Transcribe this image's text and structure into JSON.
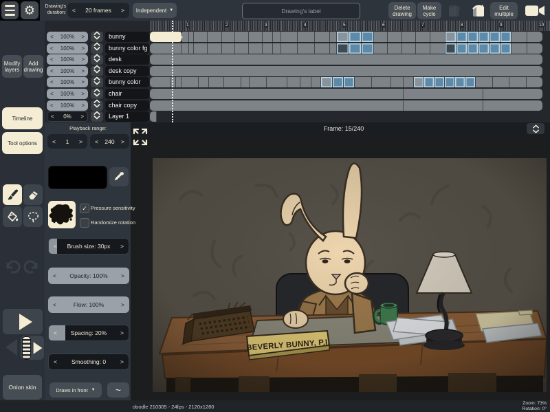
{
  "glyphs": {
    "prev": "<",
    "next": ">",
    "dropdown": "▼",
    "check": "✓",
    "squiggle": "~"
  },
  "colors": {
    "accent_cream": "#f5edd3",
    "panel_dark": "#24282d",
    "button_gray": "#464d55",
    "timeline_cell_gray": "#7e8388",
    "selected_cell_blue": "#5d8aa9",
    "blue_border": "#b9d6e6"
  },
  "topbar": {
    "drawings_duration_label": "Drawing's duration:",
    "duration_value": "20 frames",
    "independent_dropdown": "Independent",
    "drawings_label_placeholder": "Drawing's label",
    "delete_drawing": "Delete drawing",
    "make_cycle": "Make cycle",
    "edit_multiple": "Edit multiple"
  },
  "sidebar": {
    "modify_layers": "Modify layers",
    "add_drawing": "Add drawing",
    "timeline_tab": "Timeline",
    "tool_options_tab": "Tool options",
    "onion_skin": "Onion skin"
  },
  "layers": {
    "rows": [
      {
        "opacity": "100%",
        "name": "bunny"
      },
      {
        "opacity": "100%",
        "name": "bunny color fg"
      },
      {
        "opacity": "100%",
        "name": "desk"
      },
      {
        "opacity": "100%",
        "name": "desk copy"
      },
      {
        "opacity": "100%",
        "name": "bunny color"
      },
      {
        "opacity": "100%",
        "name": "chair"
      },
      {
        "opacity": "100%",
        "name": "chair copy"
      },
      {
        "opacity": "0%",
        "name": "Layer 1",
        "dim": true
      }
    ]
  },
  "timeline": {
    "ruler_numbers": [
      "1",
      "2",
      "3",
      "4",
      "5",
      "6",
      "7",
      "8",
      "9",
      "10"
    ],
    "frame_label": "Frame: 15/240",
    "playback_range_label": "Playback range:",
    "playback_start": "1",
    "playback_end": "240",
    "tracks": [
      {
        "name": "bunny",
        "segs": [
          [
            "s",
            47
          ],
          [
            "g",
            10
          ],
          [
            "g",
            7
          ],
          [
            "g",
            20
          ],
          [
            "g",
            21
          ],
          [
            "g",
            19
          ],
          [
            "g",
            20
          ],
          [
            "g",
            20
          ],
          [
            "g",
            15
          ],
          [
            "g",
            12
          ],
          [
            "g",
            24
          ],
          [
            "g",
            25
          ],
          [
            "g",
            22
          ],
          [
            "g",
            10
          ],
          [
            "bl",
            18
          ],
          [
            "b",
            18
          ],
          [
            "b",
            18
          ],
          [
            "g",
            20
          ],
          [
            "g",
            21
          ],
          [
            "g",
            20
          ],
          [
            "g",
            21
          ],
          [
            "g",
            22
          ],
          [
            "bl",
            16
          ],
          [
            "b",
            16
          ],
          [
            "b",
            16
          ],
          [
            "b",
            16
          ],
          [
            "b",
            16
          ],
          [
            "b",
            16
          ],
          [
            "g",
            23
          ],
          [
            "g",
            22
          ]
        ]
      },
      {
        "name": "bunny color fg",
        "segs": [
          [
            "g",
            47
          ],
          [
            "g",
            10
          ],
          [
            "g",
            7
          ],
          [
            "g",
            20
          ],
          [
            "g",
            21
          ],
          [
            "g",
            19
          ],
          [
            "g",
            20
          ],
          [
            "g",
            20
          ],
          [
            "g",
            15
          ],
          [
            "g",
            12
          ],
          [
            "g",
            24
          ],
          [
            "g",
            25
          ],
          [
            "g",
            22
          ],
          [
            "g",
            10
          ],
          [
            "bd",
            18
          ],
          [
            "b",
            18
          ],
          [
            "b",
            18
          ],
          [
            "g",
            20
          ],
          [
            "g",
            21
          ],
          [
            "g",
            20
          ],
          [
            "g",
            21
          ],
          [
            "g",
            22
          ],
          [
            "bd",
            16
          ],
          [
            "b",
            16
          ],
          [
            "b",
            16
          ],
          [
            "b",
            16
          ],
          [
            "b",
            16
          ],
          [
            "b",
            16
          ],
          [
            "g",
            23
          ],
          [
            "g",
            22
          ]
        ]
      },
      {
        "name": "desk",
        "segs": [
          [
            "g",
            571
          ]
        ]
      },
      {
        "name": "desk copy",
        "segs": [
          [
            "g",
            571
          ]
        ]
      },
      {
        "name": "bunny color",
        "segs": [
          [
            "g",
            30
          ],
          [
            "g",
            8
          ],
          [
            "g",
            8
          ],
          [
            "g",
            25
          ],
          [
            "g",
            15
          ],
          [
            "g",
            22
          ],
          [
            "g",
            25
          ],
          [
            "g",
            12
          ],
          [
            "g",
            25
          ],
          [
            "g",
            30
          ],
          [
            "g",
            19
          ],
          [
            "g",
            16
          ],
          [
            "g",
            14
          ],
          [
            "bl",
            17
          ],
          [
            "b",
            16
          ],
          [
            "b",
            16
          ],
          [
            "g",
            25
          ],
          [
            "g",
            28
          ],
          [
            "g",
            18
          ],
          [
            "g",
            15
          ],
          [
            "bl",
            15
          ],
          [
            "b",
            15
          ],
          [
            "b",
            15
          ],
          [
            "b",
            15
          ],
          [
            "b",
            15
          ],
          [
            "b",
            15
          ],
          [
            "g",
            25
          ],
          [
            "g",
            24
          ],
          [
            "g",
            25
          ],
          [
            "g",
            23
          ]
        ]
      },
      {
        "name": "chair",
        "segs": [
          [
            "g",
            369
          ],
          [
            "g",
            116
          ],
          [
            "g",
            86
          ]
        ]
      },
      {
        "name": "chair copy",
        "segs": [
          [
            "g",
            369
          ],
          [
            "g",
            116
          ],
          [
            "g",
            86
          ]
        ]
      },
      {
        "name": "Layer 1",
        "segs": [
          [
            "g",
            10
          ],
          [
            "x",
            561
          ]
        ]
      }
    ]
  },
  "tool_options": {
    "pressure_sensitivity": "Pressure sensitivity",
    "pressure_checked": true,
    "randomize_rotation": "Randomize rotation",
    "randomize_checked": false,
    "brush_size": "Brush size: 30px",
    "opacity": "Opacity: 100%",
    "flow": "Flow: 100%",
    "spacing": "Spacing: 20%",
    "smoothing": "Smoothing: 0",
    "draws_in_front": "Draws in front"
  },
  "statusbar": {
    "project_info": "doodle 210305 - 24fps - 2120x1280",
    "zoom": "Zoom: 73%",
    "rotation": "Rotation: 0°"
  },
  "canvas": {
    "nameplate_text": "BEVERLY BUNNY, P.I."
  }
}
